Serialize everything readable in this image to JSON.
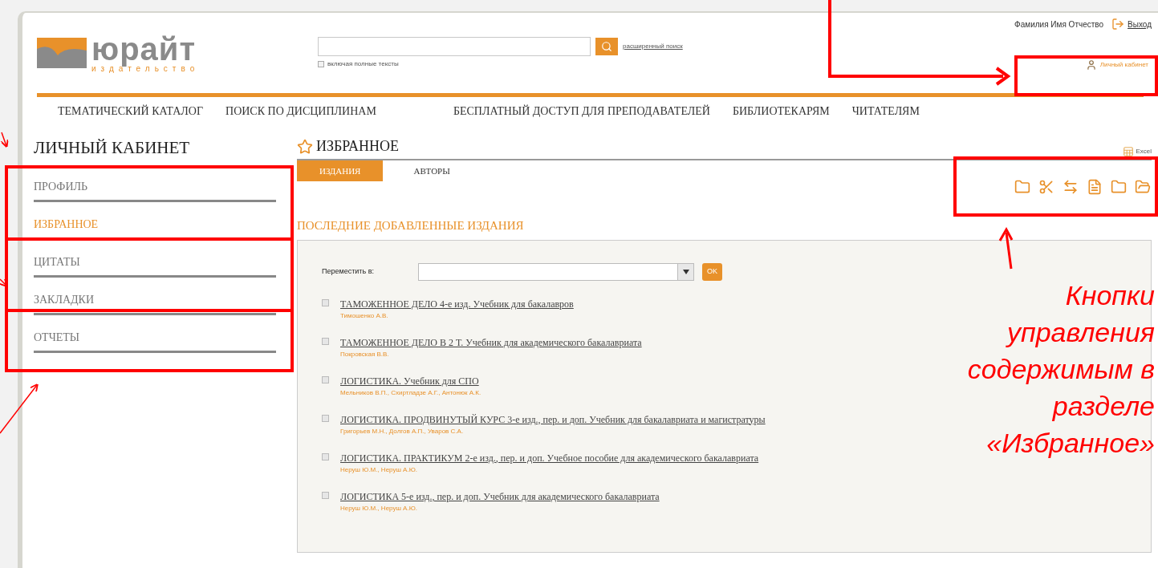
{
  "header": {
    "logo": {
      "name": "юрайт",
      "subtitle": "издательство"
    },
    "search": {
      "full_text_label": "включая полные тексты",
      "full_text_checked": false,
      "advanced_link": "расширенный поиск"
    },
    "user_name": "Фамилия Имя Отчество",
    "logout": "Выход",
    "cabinet_link": "Личный кабинет"
  },
  "nav": [
    "ТЕМАТИЧЕСКИЙ КАТАЛОГ",
    "ПОИСК ПО ДИСЦИПЛИНАМ",
    "БЕСПЛАТНЫЙ ДОСТУП ДЛЯ ПРЕПОДАВАТЕЛЕЙ",
    "БИБЛИОТЕКАРЯМ",
    "ЧИТАТЕЛЯМ"
  ],
  "sidebar": {
    "title": "ЛИЧНЫЙ КАБИНЕТ",
    "items": [
      {
        "label": "ПРОФИЛЬ",
        "selected": false
      },
      {
        "label": "ИЗБРАННОЕ",
        "selected": true
      },
      {
        "label": "ЦИТАТЫ",
        "selected": false
      },
      {
        "label": "ЗАКЛАДКИ",
        "selected": false
      },
      {
        "label": "ОТЧЕТЫ",
        "selected": false
      }
    ]
  },
  "main": {
    "title": "ИЗБРАННОЕ",
    "export": "Excel",
    "tabs": [
      {
        "label": "ИЗДАНИЯ",
        "selected": true
      },
      {
        "label": "АВТОРЫ",
        "selected": false
      }
    ],
    "section_title": "ПОСЛЕДНИЕ ДОБАВЛЕННЫЕ ИЗДАНИЯ",
    "move_label": "Переместить в:",
    "move_button": "OK",
    "books": [
      {
        "title": "ТАМОЖЕННОЕ ДЕЛО 4-е изд. Учебник для бакалавров",
        "authors": "Тимошенко А.В.",
        "checked": false
      },
      {
        "title": "ТАМОЖЕННОЕ ДЕЛО В 2 Т. Учебник для академического бакалавриата",
        "authors": "Покровская В.В.",
        "checked": false
      },
      {
        "title": "ЛОГИСТИКА. Учебник для СПО",
        "authors": "Мельников В.П., Схиртладзе А.Г., Антонюк А.К.",
        "checked": false
      },
      {
        "title": "ЛОГИСТИКА. ПРОДВИНУТЫЙ КУРС 3-е изд., пер. и доп. Учебник для бакалавриата и магистратуры",
        "authors": "Григорьев М.Н., Долгов А.П., Уваров С.А.",
        "checked": false
      },
      {
        "title": "ЛОГИСТИКА. ПРАКТИКУМ 2-е изд., пер. и доп. Учебное пособие для академического бакалавриата",
        "authors": "Неруш Ю.М., Неруш А.Ю.",
        "checked": false
      },
      {
        "title": "ЛОГИСТИКА 5-е изд., пер. и доп. Учебник для академического бакалавриата",
        "authors": "Неруш Ю.М., Неруш А.Ю.",
        "checked": false
      }
    ]
  },
  "annotation": {
    "caption": [
      "Кнопки",
      "управления",
      "содержимым в",
      "разделе",
      "«Избранное»"
    ]
  }
}
